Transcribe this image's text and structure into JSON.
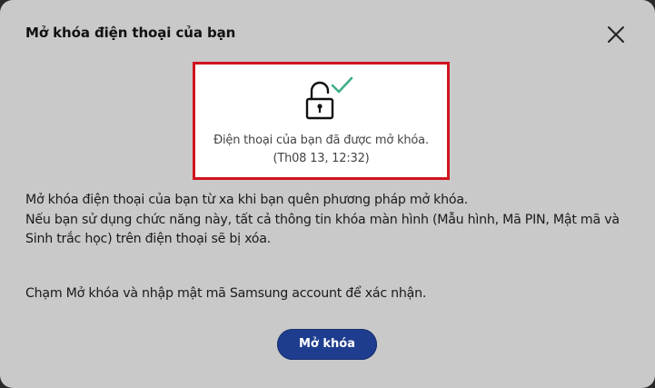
{
  "dialog": {
    "title": "Mở khóa điện thoại của bạn",
    "close_icon": "close-icon"
  },
  "status": {
    "icon": "unlocked-padlock-check-icon",
    "message": "Điện thoại của bạn đã được mở khóa.",
    "timestamp": "(Th08 13, 12:32)",
    "highlight_color": "#d0141e",
    "check_color": "#3fae8a"
  },
  "body": {
    "line1": "Mở khóa điện thoại của bạn từ xa khi bạn quên phương pháp mở khóa.",
    "line2": "Nếu bạn sử dụng chức năng này, tất cả thông tin khóa màn hình (Mẫu hình, Mã PIN, Mật mã và",
    "line3": "Sinh trắc học) trên điện thoại sẽ bị xóa.",
    "instruction": "Chạm Mở khóa và nhập mật mã Samsung account để xác nhận."
  },
  "actions": {
    "unlock_label": "Mở khóa",
    "button_color": "#1f3d8f"
  }
}
